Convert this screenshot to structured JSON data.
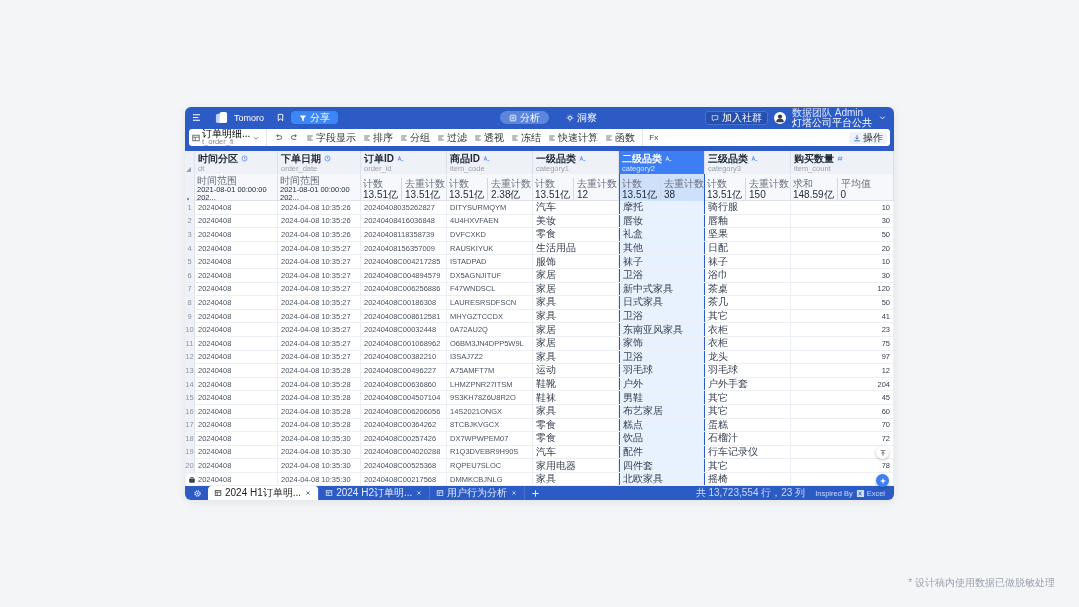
{
  "app": {
    "name": "Tomoro"
  },
  "topbar": {
    "share_button": "分享",
    "views": [
      {
        "label": "分析",
        "kind": "analysis",
        "selected": true
      },
      {
        "label": "洞察",
        "kind": "insight",
        "selected": false
      }
    ],
    "community_button": "加入社群",
    "user": {
      "name": "数据团队 Admin",
      "org": "灯塔公司平台公共"
    }
  },
  "toolbar": {
    "dataset": {
      "name": "订单明细...",
      "table": "t_order_fi"
    },
    "tools": [
      "字段显示",
      "排序",
      "分组",
      "过滤",
      "透视",
      "冻结",
      "快速计算",
      "函数"
    ],
    "formula_label": "Fx",
    "action_button": "操作"
  },
  "table": {
    "columns": [
      {
        "title": "时间分区",
        "field": "dt",
        "kind": "time",
        "selected": false,
        "summary": {
          "kind": "range",
          "label": "时间范围",
          "value": "2021-08-01 00:00:00   202..."
        }
      },
      {
        "title": "下单日期",
        "field": "order_date",
        "kind": "time",
        "selected": false,
        "summary": {
          "kind": "range",
          "label": "时间范围",
          "value": "2021-08-01 00:00:00   202..."
        }
      },
      {
        "title": "订单ID",
        "field": "order_id",
        "kind": "text",
        "selected": false,
        "summary": {
          "kind": "stats",
          "stats": [
            {
              "label": "计数",
              "value": "13.51亿"
            },
            {
              "label": "去重计数",
              "value": "13.51亿"
            }
          ]
        }
      },
      {
        "title": "商品ID",
        "field": "item_code",
        "kind": "text",
        "selected": false,
        "summary": {
          "kind": "stats",
          "stats": [
            {
              "label": "计数",
              "value": "13.51亿"
            },
            {
              "label": "去重计数",
              "value": "2.38亿"
            }
          ]
        }
      },
      {
        "title": "一级品类",
        "field": "category1",
        "kind": "text",
        "selected": false,
        "summary": {
          "kind": "stats",
          "stats": [
            {
              "label": "计数",
              "value": "13.51亿"
            },
            {
              "label": "去重计数",
              "value": "12"
            }
          ]
        }
      },
      {
        "title": "二级品类",
        "field": "category2",
        "kind": "text",
        "selected": true,
        "summary": {
          "kind": "stats",
          "stats": [
            {
              "label": "计数",
              "value": "13.51亿"
            },
            {
              "label": "去重计数",
              "value": "38"
            }
          ]
        }
      },
      {
        "title": "三级品类",
        "field": "category3",
        "kind": "text",
        "selected": false,
        "summary": {
          "kind": "stats",
          "stats": [
            {
              "label": "计数",
              "value": "13.51亿"
            },
            {
              "label": "去重计数",
              "value": "150"
            }
          ]
        }
      },
      {
        "title": "购买数量",
        "field": "item_count",
        "kind": "number",
        "selected": false,
        "summary": {
          "kind": "stats",
          "stats": [
            {
              "label": "求和",
              "value": "148.59亿"
            },
            {
              "label": "平均值",
              "value": "0"
            }
          ]
        }
      }
    ],
    "rows": [
      {
        "n": "1",
        "cells": [
          "20240408",
          "2024-04-08 10:35:26",
          "20240408035262827",
          "DITYSURMQYM",
          "汽车",
          "摩托",
          "骑行服",
          "10"
        ]
      },
      {
        "n": "2",
        "cells": [
          "20240408",
          "2024-04-08 10:35:26",
          "20240408416036848",
          "4U4HXVFAEN",
          "美妆",
          "唇妆",
          "唇釉",
          "30"
        ]
      },
      {
        "n": "3",
        "cells": [
          "20240408",
          "2024-04-08 10:35:26",
          "20240408118358739",
          "DVFCXKD",
          "零食",
          "礼盒",
          "坚果",
          "50"
        ]
      },
      {
        "n": "4",
        "cells": [
          "20240408",
          "2024-04-08 10:35:27",
          "20240408156357009",
          "RAUSKIYUK",
          "生活用品",
          "其他",
          "日配",
          "20"
        ]
      },
      {
        "n": "5",
        "cells": [
          "20240408",
          "2024-04-08 10:35:27",
          "20240408C004217285",
          "ISTADPAD",
          "服饰",
          "袜子",
          "袜子",
          "10"
        ]
      },
      {
        "n": "6",
        "cells": [
          "20240408",
          "2024-04-08 10:35:27",
          "20240408C004894579",
          "DX5AGNJITUF",
          "家居",
          "卫浴",
          "浴巾",
          "30"
        ]
      },
      {
        "n": "7",
        "cells": [
          "20240408",
          "2024-04-08 10:35:27",
          "20240408C006256886",
          "F47WNDSCL",
          "家居",
          "新中式家具",
          "茶桌",
          "120"
        ]
      },
      {
        "n": "8",
        "cells": [
          "20240408",
          "2024-04-08 10:35:27",
          "20240408C00186308",
          "LAURESRSDFSCN",
          "家具",
          "日式家具",
          "茶几",
          "50"
        ]
      },
      {
        "n": "9",
        "cells": [
          "20240408",
          "2024-04-08 10:35:27",
          "20240408C008612581",
          "MHYGZTCCDX",
          "家具",
          "卫浴",
          "其它",
          "41"
        ]
      },
      {
        "n": "10",
        "cells": [
          "20240408",
          "2024-04-08 10:35:27",
          "20240408C00032448",
          "0A72AU2Q",
          "家居",
          "东南亚风家具",
          "衣柜",
          "23"
        ]
      },
      {
        "n": "11",
        "cells": [
          "20240408",
          "2024-04-08 10:35:27",
          "20240408C001068962",
          "O6BM3JN4DPP5W9L",
          "家居",
          "家饰",
          "衣柜",
          "75"
        ]
      },
      {
        "n": "12",
        "cells": [
          "20240408",
          "2024-04-08 10:35:27",
          "20240408C00382210",
          "I3SAJ7Z2",
          "家具",
          "卫浴",
          "龙头",
          "97"
        ]
      },
      {
        "n": "13",
        "cells": [
          "20240408",
          "2024-04-08 10:35:28",
          "20240408C00496227",
          "A75AMFT7M",
          "运动",
          "羽毛球",
          "羽毛球",
          "12"
        ]
      },
      {
        "n": "14",
        "cells": [
          "20240408",
          "2024-04-08 10:35:28",
          "20240408C00636860",
          "LHMZPNR27ITSM",
          "鞋靴",
          "户外",
          "户外手套",
          "204"
        ]
      },
      {
        "n": "15",
        "cells": [
          "20240408",
          "2024-04-08 10:35:28",
          "20240408C004507104",
          "9S3KH78Z6U8R2O",
          "鞋袜",
          "男鞋",
          "其它",
          "45"
        ]
      },
      {
        "n": "16",
        "cells": [
          "20240408",
          "2024-04-08 10:35:28",
          "20240408C006206056",
          "14S2021ONGX",
          "家具",
          "布艺家居",
          "其它",
          "60"
        ]
      },
      {
        "n": "17",
        "cells": [
          "20240408",
          "2024-04-08 10:35:28",
          "20240408C00364262",
          "8TCBJKVGCX",
          "零食",
          "糕点",
          "蛋糕",
          "70"
        ]
      },
      {
        "n": "18",
        "cells": [
          "20240408",
          "2024-04-08 10:35:30",
          "20240408C00257426",
          "DX7WPWPEM07",
          "零食",
          "饮品",
          "石榴汁",
          "72"
        ]
      },
      {
        "n": "19",
        "cells": [
          "20240408",
          "2024-04-08 10:35:30",
          "20240408C004020288",
          "R1Q3DVEBR9H90S",
          "汽车",
          "配件",
          "行车记录仪"
        ]
      },
      {
        "n": "20",
        "cells": [
          "20240408",
          "2024-04-08 10:35:30",
          "20240408C00525368",
          "RQPEU7SLOC",
          "家用电器",
          "四件套",
          "其它",
          "78"
        ]
      },
      {
        "cells": [
          "20240408",
          "2024-04-08 10:35:30",
          "20240408C00217568",
          "DMMKCBJNLG",
          "家具",
          "北欧家具",
          "摇椅"
        ]
      }
    ]
  },
  "sheets": [
    {
      "label": "2024 H1订单明...",
      "selected": true
    },
    {
      "label": "2024 H2订单明...",
      "selected": false
    },
    {
      "label": "用户行为分析",
      "selected": false
    }
  ],
  "status": {
    "summary": "共 13,723,554 行，23 列",
    "credit": "Inspired By",
    "product": "Excel"
  },
  "footnote": "* 设计稿内使用数据已做脱敏处理"
}
